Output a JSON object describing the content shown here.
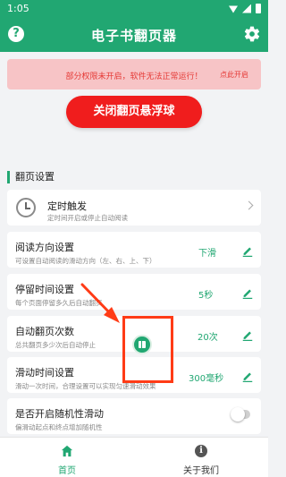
{
  "status_bar": {
    "time": "1:05"
  },
  "app_bar": {
    "title": "电子书翻页器",
    "help_icon_glyph": "?"
  },
  "alert": {
    "message": "部分权限未开启，软件无法正常运行！",
    "action": "点此开启"
  },
  "main_button": {
    "label": "关闭翻页悬浮球"
  },
  "section": {
    "title": "翻页设置"
  },
  "settings": [
    {
      "title": "定时触发",
      "subtitle": "定时间开启或停止自动阅读",
      "value": "",
      "control": "chevron"
    },
    {
      "title": "阅读方向设置",
      "subtitle": "可设置自动阅读的滑动方向（左、右、上、下）",
      "value": "下滑",
      "control": "edit"
    },
    {
      "title": "停留时间设置",
      "subtitle": "每个页面停留多久后自动翻页",
      "value": "5秒",
      "control": "edit"
    },
    {
      "title": "自动翻页次数",
      "subtitle": "总共翻页多少次后自动停止",
      "value": "20次",
      "control": "edit"
    },
    {
      "title": "滑动时间设置",
      "subtitle": "滑动一次时间，合理设置可以实现匀速滑动效果",
      "value": "300毫秒",
      "control": "edit"
    },
    {
      "title": "是否开启随机性滑动",
      "subtitle": "偏滑动起点和终点增加随机性",
      "value": "",
      "control": "toggle",
      "toggle_on": false
    }
  ],
  "bottom_nav": [
    {
      "label": "首页",
      "icon": "home-icon",
      "active": true
    },
    {
      "label": "关于我们",
      "icon": "info-icon",
      "active": false,
      "icon_glyph": "i"
    }
  ],
  "colors": {
    "primary": "#21a772",
    "danger": "#f01d1d",
    "alert_bg": "#f7c4c6",
    "annotation": "#ff3b16"
  }
}
